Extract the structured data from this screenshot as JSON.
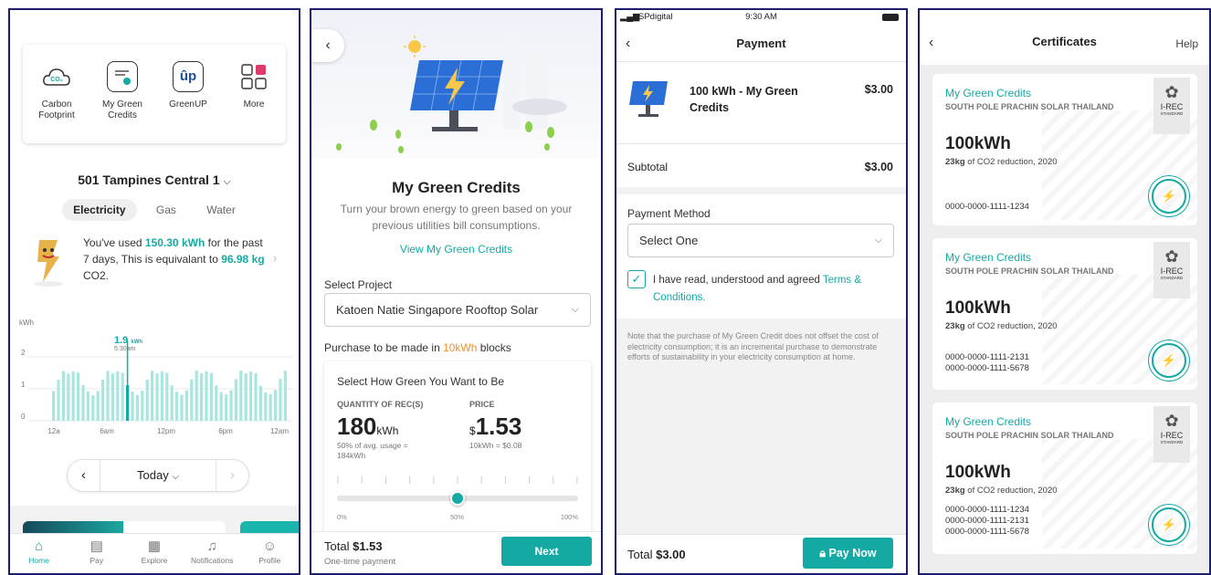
{
  "home": {
    "quick_actions": [
      {
        "label": "Carbon Footprint",
        "icon": "co2-cloud-icon"
      },
      {
        "label": "My Green Credits",
        "icon": "certificate-icon"
      },
      {
        "label": "GreenUP",
        "icon": "greenup-icon"
      },
      {
        "label": "More",
        "icon": "grid-icon"
      }
    ],
    "address": "501 Tampines Central 1",
    "tabs": [
      "Electricity",
      "Gas",
      "Water"
    ],
    "usage": {
      "pre": "You've used ",
      "kwh": "150.30 kWh",
      "mid": " for the past 7 days, This is equivalant to ",
      "co2": "96.98 kg",
      "post": " CO2."
    },
    "chart": {
      "unit": "kWh",
      "y_ticks": [
        "2",
        "1",
        "0"
      ],
      "x_ticks": [
        "12a",
        "6am",
        "12pm",
        "6pm",
        "12am"
      ],
      "tooltip_value": "1.9",
      "tooltip_unit": "kWh",
      "tooltip_time": "5:30am"
    },
    "date_label": "Today",
    "nav": [
      "Home",
      "Pay",
      "Explore",
      "Notifications",
      "Profile"
    ]
  },
  "green": {
    "title": "My Green Credits",
    "subtitle": "Turn your brown energy to green based on your previous utilities bill consumptions.",
    "view_link": "View My Green Credits",
    "select_project_label": "Select Project",
    "project": "Katoen Natie Singapore Rooftop Solar",
    "purchase_note_pre": "Purchase to be made in ",
    "purchase_note_block": "10kWh",
    "purchase_note_post": " blocks",
    "card_title": "Select How Green You Want to Be",
    "qty_label": "QUANTITY OF REC(S)",
    "qty_value": "180",
    "qty_unit": "kWh",
    "qty_note": "50% of avg. usage = 184kWh",
    "price_label": "PRICE",
    "price_currency": "$",
    "price_value": "1.53",
    "price_note": "10kWh = $0.08",
    "slider_marks": [
      "0%",
      "50%",
      "100%"
    ],
    "slider_value": 0.5,
    "total_label": "Total",
    "total_value": "$1.53",
    "total_note": "One-time payment",
    "next_label": "Next"
  },
  "payment": {
    "carrier": "SPdigital",
    "time": "9:30 AM",
    "title": "Payment",
    "item_name": "100 kWh -  My Green Credits",
    "item_price": "$3.00",
    "subtotal_label": "Subtotal",
    "subtotal_value": "$3.00",
    "method_label": "Payment  Method",
    "method_value": "Select One",
    "agree_pre": "I have read, understood and agreed ",
    "agree_link": "Terms & Conditions.",
    "note": "Note that the purchase of My Green Credit does not offset the cost of electricity consumption; it is an incremental purchase to demonstrate efforts of sustainability in your electricity consumption at home.",
    "total_label": "Total",
    "total_value": "$3.00",
    "pay_label": "Pay Now"
  },
  "certs": {
    "title": "Certificates",
    "help": "Help",
    "items": [
      {
        "name": "My Green Credits",
        "project": "SOUTH POLE PRACHIN SOLAR THAILAND",
        "amount": "100kWh",
        "co2": "23kg",
        "co2_text": " of CO2 reduction, 2020",
        "ids": "0000-0000-1111-1234"
      },
      {
        "name": "My Green Credits",
        "project": "SOUTH POLE PRACHIN SOLAR THAILAND",
        "amount": "100kWh",
        "co2": "23kg",
        "co2_text": " of CO2 reduction, 2020",
        "ids": "0000-0000-1111-2131\n0000-0000-1111-5678"
      },
      {
        "name": "My Green Credits",
        "project": "SOUTH POLE PRACHIN SOLAR THAILAND",
        "amount": "100kWh",
        "co2": "23kg",
        "co2_text": " of CO2 reduction, 2020",
        "ids": "0000-0000-1111-1234\n0000-0000-1111-2131\n0000-0000-1111-5678"
      }
    ],
    "badge_top": "I-REC",
    "badge_bottom": "STANDARD"
  },
  "colors": {
    "accent": "#14aaa3",
    "orange": "#f0902a",
    "frame": "#1e1e6e"
  }
}
